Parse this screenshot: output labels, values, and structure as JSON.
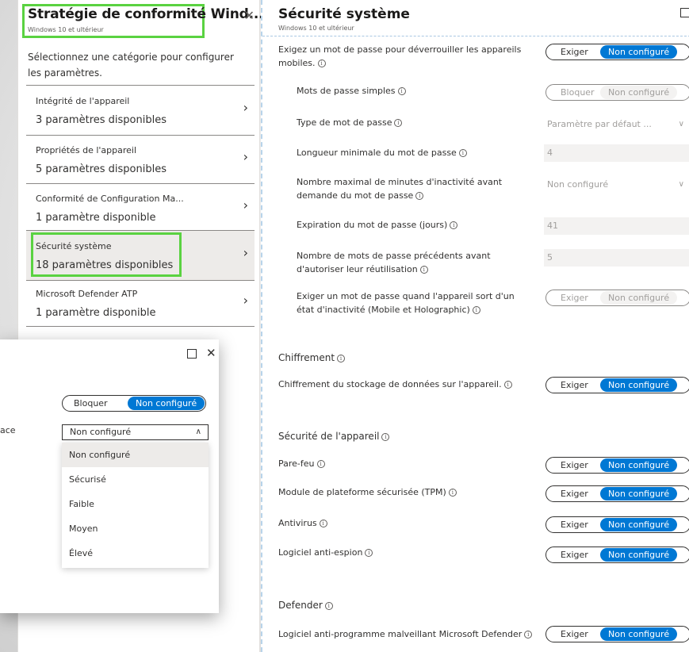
{
  "left_blade": {
    "title": "Stratégie de conformité Wind...",
    "subtitle": "Windows 10 et ultérieur",
    "intro": "Sélectionnez une catégorie pour configurer les paramètres.",
    "categories": [
      {
        "name": "Intégrité de l'appareil",
        "count": "3 paramètres disponibles"
      },
      {
        "name": "Propriétés de l'appareil",
        "count": "5 paramètres disponibles"
      },
      {
        "name": "Conformité de Configuration Ma...",
        "count": "1 paramètre disponible"
      },
      {
        "name": "Sécurité système",
        "count": "18 paramètres disponibles"
      },
      {
        "name": "Microsoft Defender ATP",
        "count": "1 paramètre disponible"
      }
    ]
  },
  "right_blade": {
    "title": "Sécurité système",
    "subtitle": "Windows 10 et ultérieur",
    "toggle_exiger": "Exiger",
    "toggle_bloquer": "Bloquer",
    "toggle_nc": "Non configuré",
    "settings": {
      "unlock_pwd": "Exigez un mot de passe pour déverrouiller les appareils mobiles.",
      "simple_pwd": "Mots de passe simples",
      "pwd_type": "Type de mot de passe",
      "pwd_type_value": "Paramètre par défaut ...",
      "min_len": "Longueur minimale du mot de passe",
      "min_len_value": "4",
      "max_idle": "Nombre maximal de minutes d'inactivité avant demande du mot de passe",
      "max_idle_value": "Non configuré",
      "expiry": "Expiration du mot de passe (jours)",
      "expiry_value": "41",
      "prev_pwd": "Nombre de mots de passe précédents avant d'autoriser leur réutilisation",
      "prev_pwd_value": "5",
      "idle_return": "Exiger un mot de passe quand l'appareil sort d'un état d'inactivité (Mobile et Holographic)"
    },
    "encryption_header": "Chiffrement",
    "encryption_storage": "Chiffrement du stockage de données sur l'appareil.",
    "device_security_header": "Sécurité de l'appareil",
    "firewall": "Pare-feu",
    "tpm": "Module de plateforme sécurisée (TPM)",
    "antivirus": "Antivirus",
    "antispyware": "Logiciel anti-espion",
    "defender_header": "Defender",
    "defender_antimalware": "Logiciel anti-programme malveillant Microsoft Defender"
  },
  "popup": {
    "label": "ace",
    "toggle_a": "Bloquer",
    "toggle_b": "Non configuré",
    "select_value": "Non configuré",
    "options": [
      "Non configuré",
      "Sécurisé",
      "Faible",
      "Moyen",
      "Élevé"
    ]
  }
}
